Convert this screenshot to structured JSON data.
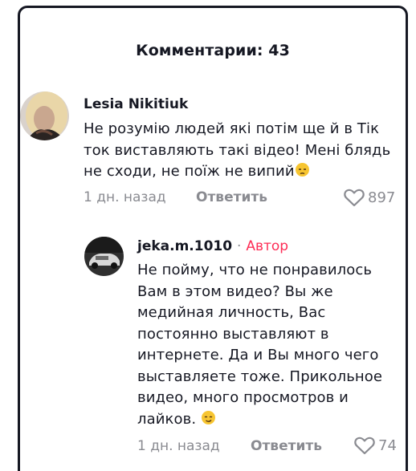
{
  "header": {
    "title": "Комментарии: 43"
  },
  "comments": [
    {
      "username": "Lesia Nikitiuk",
      "text": "Не розумію людей які потім ще й в Тік\nток виставляють такі відео! Мені блядь\nне сходи, не поїж не випий",
      "emoji": "unamused-face-emoji",
      "time": "1 дн. назад",
      "reply_label": "Ответить",
      "likes": "897"
    },
    {
      "username": "jeka.m.1010",
      "separator": "·",
      "author_label": "Автор",
      "text": "Не пойму, что не понравилось\nВам в этом видео? Вы же\nмедийная личность, Вас\nпостоянно выставляют в\nинтернете. Да и Вы много чего\nвыставляете тоже. Прикольное\nвидео, много просмотров и\nлайков.",
      "emoji": "smirking-face-emoji",
      "time": "1 дн. назад",
      "reply_label": "Ответить",
      "likes": "74"
    }
  ],
  "colors": {
    "text": "#161823",
    "muted": "#8a8b91",
    "author": "#fe2c55"
  }
}
